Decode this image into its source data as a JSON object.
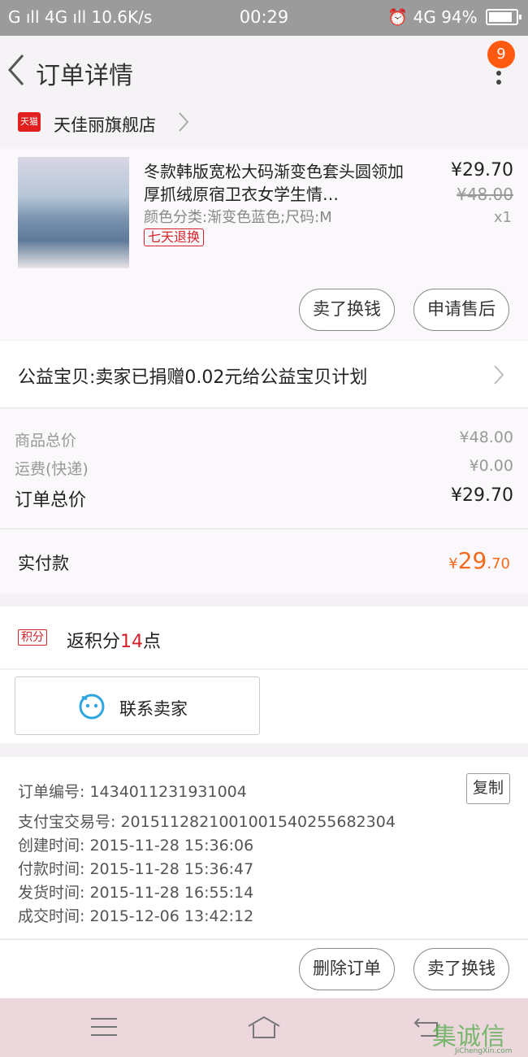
{
  "status_bar": {
    "left": "G ıll 4G ıll 10.6K/s",
    "time": "00:29",
    "network": "4G",
    "battery": "94%"
  },
  "header": {
    "title": "订单详情",
    "badge_count": "9"
  },
  "shop": {
    "platform_icon_label": "天猫",
    "name": "天佳丽旗舰店"
  },
  "product": {
    "title": "冬款韩版宽松大码渐变色套头圆领加厚抓绒原宿卫衣女学生情…",
    "spec": "颜色分类:渐变色蓝色;尺码:M",
    "tag": "七天退换",
    "price": "¥29.70",
    "original_price": "¥48.00",
    "quantity": "x1",
    "buttons": {
      "sell": "卖了换钱",
      "after_sale": "申请售后"
    }
  },
  "charity": {
    "text": "公益宝贝:卖家已捐赠0.02元给公益宝贝计划"
  },
  "totals": {
    "goods_label": "商品总价",
    "goods_value": "¥48.00",
    "shipping_label": "运费(快递)",
    "shipping_value": "¥0.00",
    "order_label": "订单总价",
    "order_value": "¥29.70"
  },
  "paid": {
    "label": "实付款",
    "currency": "¥",
    "integer": "29",
    "decimal": ".70"
  },
  "points": {
    "tag": "积分",
    "prefix": "返积分",
    "number": "14",
    "suffix": "点"
  },
  "contact": {
    "label": "联系卖家"
  },
  "order_info": {
    "order_no": "订单编号: 1434011231931004",
    "copy_label": "复制",
    "alipay_no": "支付宝交易号: 2015112821001001540255682304",
    "created": "创建时间: 2015-11-28 15:36:06",
    "paid": "付款时间: 2015-11-28 15:36:47",
    "shipped": "发货时间: 2015-11-28 16:55:14",
    "completed": "成交时间: 2015-12-06 13:42:12"
  },
  "actions": {
    "delete": "删除订单",
    "sell": "卖了换钱"
  },
  "watermark": {
    "text": "集诚信",
    "sub": "JiChengXin.com"
  },
  "colors": {
    "accent_orange": "#f16a1d",
    "tag_red": "#d4212a",
    "badge": "#ff5a10",
    "status_bar": "#9b9b9b",
    "nav_bar": "#ecd7dd"
  }
}
